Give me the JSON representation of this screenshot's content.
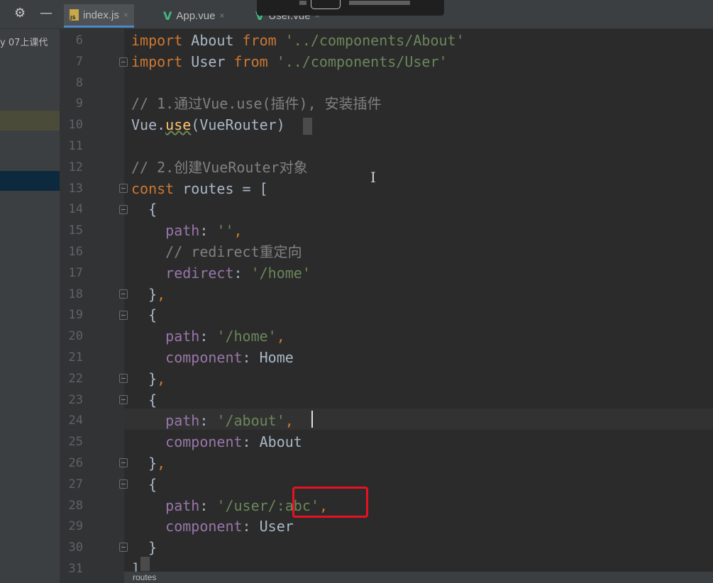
{
  "toolbar": {
    "settings_icon": "gear-icon",
    "minimize_icon": "minus-icon"
  },
  "tabs": [
    {
      "label": "index.js",
      "icon": "js-file-icon",
      "active": true
    },
    {
      "label": "App.vue",
      "icon": "vue-icon",
      "active": false
    },
    {
      "label": "User.vue",
      "icon": "vue-icon",
      "active": false
    }
  ],
  "tab_close": "×",
  "sidebar": {
    "crumb": "y 07上课代"
  },
  "bottom": {
    "label": "routes"
  },
  "ibeam": "I",
  "lines": [
    {
      "n": "6",
      "tokens": [
        [
          "kw",
          "import"
        ],
        [
          "plain",
          " About "
        ],
        [
          "kw",
          "from"
        ],
        [
          "plain",
          " "
        ],
        [
          "str",
          "'../components/About'"
        ]
      ]
    },
    {
      "n": "7",
      "tokens": [
        [
          "kw",
          "import"
        ],
        [
          "plain",
          " User "
        ],
        [
          "kw",
          "from"
        ],
        [
          "plain",
          " "
        ],
        [
          "str",
          "'../components/User'"
        ]
      ]
    },
    {
      "n": "8",
      "tokens": []
    },
    {
      "n": "9",
      "tokens": [
        [
          "cm",
          "// 1.通过Vue.use(插件), 安装插件"
        ]
      ]
    },
    {
      "n": "10",
      "tokens": [
        [
          "plain",
          "Vue."
        ],
        [
          "fn",
          "use"
        ],
        [
          "plain",
          "(VueRouter)"
        ]
      ]
    },
    {
      "n": "11",
      "tokens": []
    },
    {
      "n": "12",
      "tokens": [
        [
          "cm",
          "// 2.创建VueRouter对象"
        ]
      ]
    },
    {
      "n": "13",
      "tokens": [
        [
          "kw",
          "const"
        ],
        [
          "plain",
          " routes = ["
        ]
      ]
    },
    {
      "n": "14",
      "tokens": [
        [
          "plain",
          "  {"
        ]
      ]
    },
    {
      "n": "15",
      "tokens": [
        [
          "plain",
          "    "
        ],
        [
          "prop",
          "path"
        ],
        [
          "plain",
          ": "
        ],
        [
          "str",
          "''"
        ],
        [
          "kw",
          ","
        ]
      ]
    },
    {
      "n": "16",
      "tokens": [
        [
          "plain",
          "    "
        ],
        [
          "cm",
          "// redirect重定向"
        ]
      ]
    },
    {
      "n": "17",
      "tokens": [
        [
          "plain",
          "    "
        ],
        [
          "prop",
          "redirect"
        ],
        [
          "plain",
          ": "
        ],
        [
          "str",
          "'/home'"
        ]
      ]
    },
    {
      "n": "18",
      "tokens": [
        [
          "plain",
          "  }"
        ],
        [
          "kw",
          ","
        ]
      ]
    },
    {
      "n": "19",
      "tokens": [
        [
          "plain",
          "  {"
        ]
      ]
    },
    {
      "n": "20",
      "tokens": [
        [
          "plain",
          "    "
        ],
        [
          "prop",
          "path"
        ],
        [
          "plain",
          ": "
        ],
        [
          "str",
          "'/home'"
        ],
        [
          "kw",
          ","
        ]
      ]
    },
    {
      "n": "21",
      "tokens": [
        [
          "plain",
          "    "
        ],
        [
          "prop",
          "component"
        ],
        [
          "plain",
          ": Home"
        ]
      ]
    },
    {
      "n": "22",
      "tokens": [
        [
          "plain",
          "  }"
        ],
        [
          "kw",
          ","
        ]
      ]
    },
    {
      "n": "23",
      "tokens": [
        [
          "plain",
          "  {"
        ]
      ]
    },
    {
      "n": "24",
      "tokens": [
        [
          "plain",
          "    "
        ],
        [
          "prop",
          "path"
        ],
        [
          "plain",
          ": "
        ],
        [
          "str",
          "'/about'"
        ],
        [
          "kw",
          ","
        ]
      ]
    },
    {
      "n": "25",
      "tokens": [
        [
          "plain",
          "    "
        ],
        [
          "prop",
          "component"
        ],
        [
          "plain",
          ": About"
        ]
      ]
    },
    {
      "n": "26",
      "tokens": [
        [
          "plain",
          "  }"
        ],
        [
          "kw",
          ","
        ]
      ]
    },
    {
      "n": "27",
      "tokens": [
        [
          "plain",
          "  {"
        ]
      ]
    },
    {
      "n": "28",
      "tokens": [
        [
          "plain",
          "    "
        ],
        [
          "prop",
          "path"
        ],
        [
          "plain",
          ": "
        ],
        [
          "str",
          "'/user/:abc'"
        ],
        [
          "kw",
          ","
        ]
      ]
    },
    {
      "n": "29",
      "tokens": [
        [
          "plain",
          "    "
        ],
        [
          "prop",
          "component"
        ],
        [
          "plain",
          ": User"
        ]
      ]
    },
    {
      "n": "30",
      "tokens": [
        [
          "plain",
          "  }"
        ]
      ]
    },
    {
      "n": "31",
      "tokens": [
        [
          "plain",
          "]"
        ]
      ]
    }
  ]
}
